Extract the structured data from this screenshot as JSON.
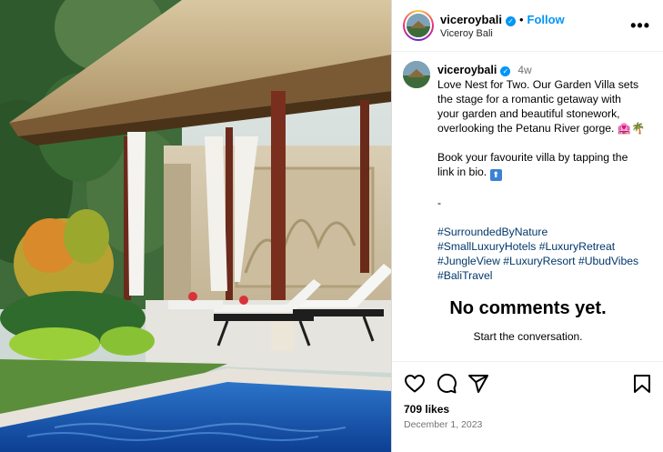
{
  "post": {
    "header": {
      "username": "viceroybali",
      "separator": "•",
      "follow_label": "Follow",
      "location": "Viceroy Bali",
      "verified_glyph": "✓",
      "more_glyph": "•••"
    },
    "caption": {
      "username": "viceroybali",
      "time_ago": "4w",
      "lines": [
        "Love Nest for Two. Our Garden Villa sets",
        "the stage for a romantic getaway with",
        "your garden and beautiful stonework,",
        "overlooking the Petanu River gorge. 🏩🌴"
      ],
      "cta_lines": [
        "Book your favourite villa by tapping the",
        "link in bio."
      ],
      "cta_emoji": "⬆",
      "dash": "-",
      "hashtags": [
        "#SurroundedByNature",
        "#SmallLuxuryHotels",
        "#LuxuryRetreat",
        "#JungleView",
        "#LuxuryResort",
        "#UbudVibes",
        "#BaliTravel"
      ]
    },
    "comments": {
      "empty_title": "No comments yet.",
      "empty_subtitle": "Start the conversation."
    },
    "actions": {
      "icons": [
        "heart-icon",
        "comment-icon",
        "share-icon",
        "bookmark-icon"
      ],
      "likes": "709 likes",
      "date": "December 1, 2023"
    },
    "colors": {
      "link_blue": "#0095f6",
      "hashtag": "#00376b",
      "muted": "#737373"
    }
  }
}
